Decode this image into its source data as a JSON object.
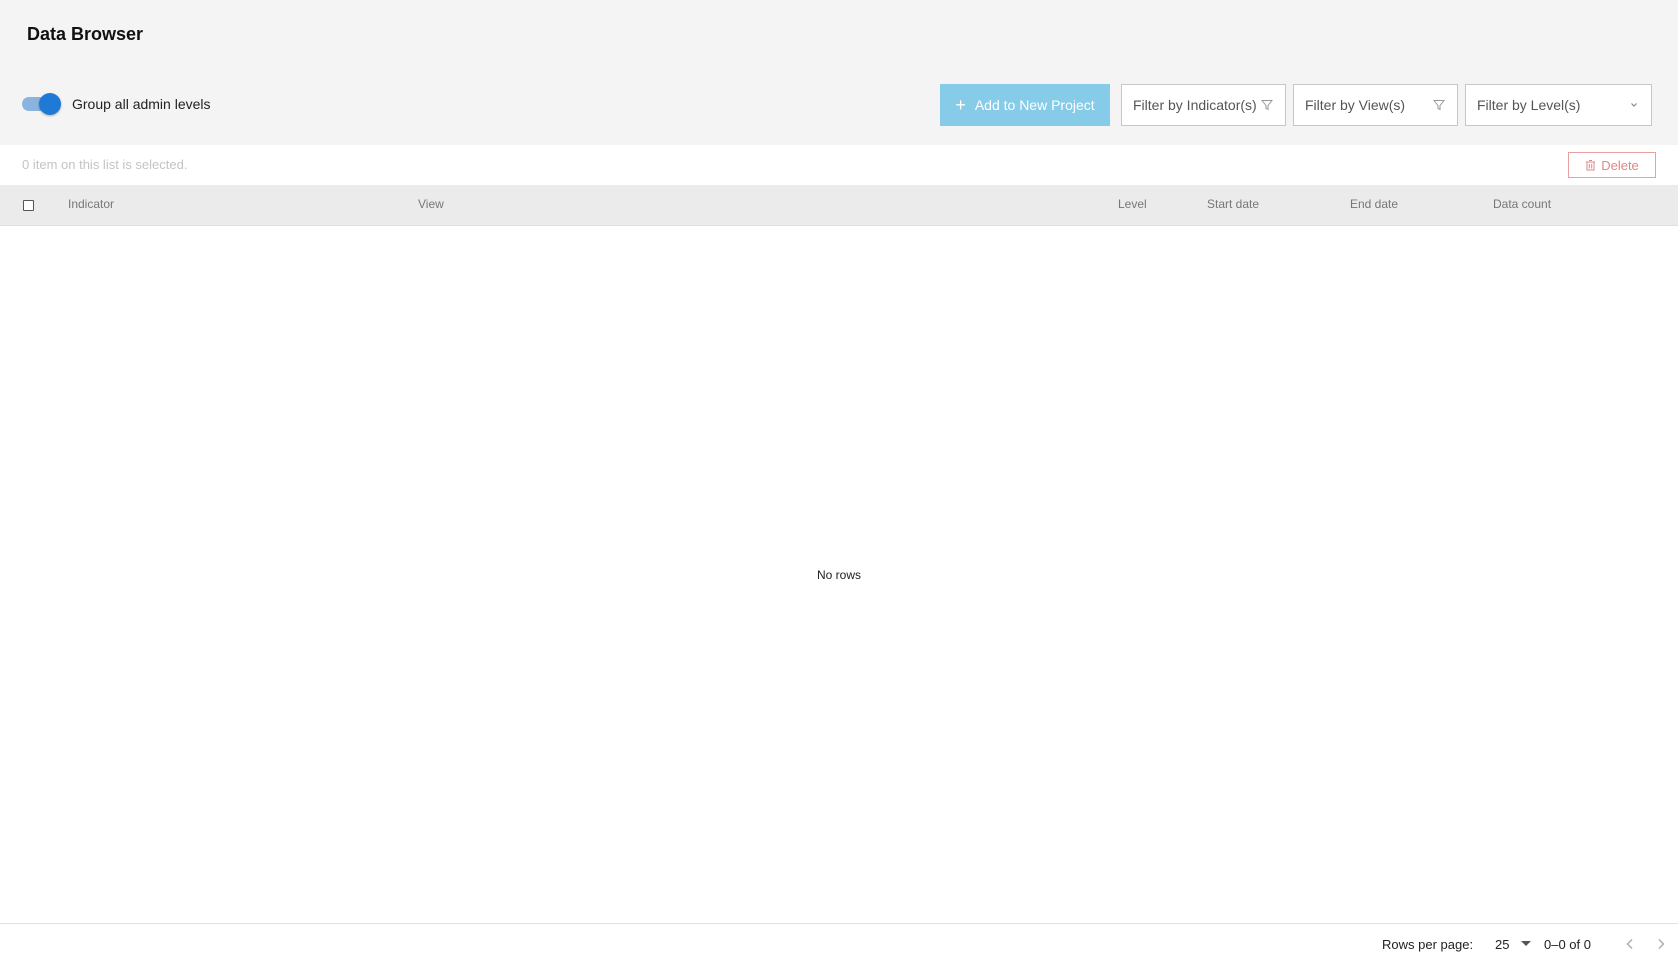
{
  "header": {
    "title": "Data Browser",
    "toggle": {
      "label": "Group all admin levels",
      "checked": true,
      "accent": "#1f7ad6"
    },
    "add_button": {
      "label": "Add to New Project",
      "icon": "plus-icon",
      "color": "#86cbe8"
    },
    "filters": [
      {
        "label": "Filter by Indicator(s)",
        "icon": "filter-icon"
      },
      {
        "label": "Filter by View(s)",
        "icon": "filter-icon"
      },
      {
        "label": "Filter by Level(s)",
        "icon": "chevron-down-icon"
      }
    ]
  },
  "selection": {
    "text": "0 item on this list is selected.",
    "delete_label": "Delete",
    "delete_icon": "trash-icon",
    "delete_color": "#e08787"
  },
  "table": {
    "columns": [
      "Indicator",
      "View",
      "Level",
      "Start date",
      "End date",
      "Data count"
    ],
    "empty_text": "No rows"
  },
  "footer": {
    "rows_per_page_label": "Rows per page:",
    "rows_per_page_value": "25",
    "range_text": "0–0 of 0"
  }
}
